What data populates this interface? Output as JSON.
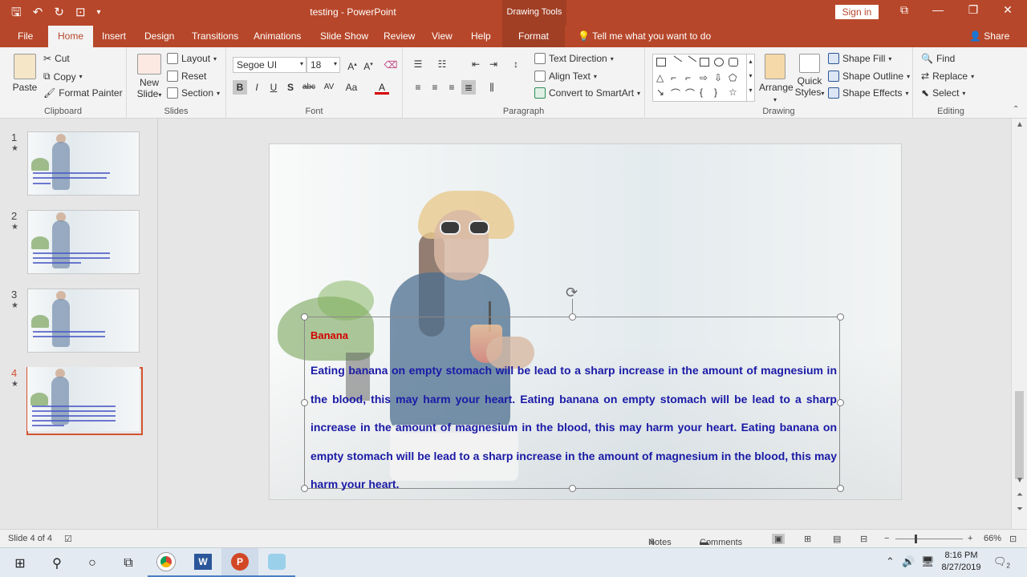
{
  "title_bar": {
    "document": "testing",
    "separator": "-",
    "app": "PowerPoint",
    "contextual": "Drawing Tools",
    "sign_in": "Sign in"
  },
  "tabs": [
    "File",
    "Home",
    "Insert",
    "Design",
    "Transitions",
    "Animations",
    "Slide Show",
    "Review",
    "View",
    "Help",
    "Format"
  ],
  "tell_me": "Tell me what you want to do",
  "share": "Share",
  "ribbon": {
    "clipboard": {
      "paste": "Paste",
      "cut": "Cut",
      "copy": "Copy",
      "format_painter": "Format Painter",
      "label": "Clipboard"
    },
    "slides": {
      "new_slide_1": "New",
      "new_slide_2": "Slide",
      "layout": "Layout",
      "reset": "Reset",
      "section": "Section",
      "label": "Slides"
    },
    "font": {
      "family": "Segoe UI",
      "size": "18",
      "bold": "B",
      "italic": "I",
      "underline": "U",
      "shadow": "S",
      "strike": "abc",
      "spacing": "AV",
      "case": "Aa",
      "color": "A",
      "label": "Font"
    },
    "paragraph": {
      "text_direction": "Text Direction",
      "align_text": "Align Text",
      "smartart": "Convert to SmartArt",
      "label": "Paragraph"
    },
    "drawing": {
      "arrange": "Arrange",
      "quick_styles_1": "Quick",
      "quick_styles_2": "Styles",
      "shape_fill": "Shape Fill",
      "shape_outline": "Shape Outline",
      "shape_effects": "Shape Effects",
      "label": "Drawing"
    },
    "editing": {
      "find": "Find",
      "replace": "Replace",
      "select": "Select",
      "label": "Editing"
    }
  },
  "slides": [
    {
      "number": "1"
    },
    {
      "number": "2"
    },
    {
      "number": "3"
    },
    {
      "number": "4"
    }
  ],
  "textbox": {
    "title": "Banana",
    "body": "Eating banana on empty stomach will be lead to a sharp increase in the amount of magnesium in the blood, this may harm your heart. Eating banana on empty stomach will be lead to a sharp increase in the amount of magnesium in the blood, this may harm your heart. Eating banana on empty stomach will be lead to a sharp increase in the amount of magnesium in the blood, this may harm your heart."
  },
  "status": {
    "slide_counter": "Slide 4 of 4",
    "notes": "Notes",
    "comments": "Comments",
    "zoom": "66%"
  },
  "taskbar": {
    "time": "8:16 PM",
    "date": "8/27/2019",
    "notification_count": "2"
  },
  "colors": {
    "accent": "#b7472a",
    "title_text": "#d40000",
    "body_text": "#1a1aa6",
    "active_thumb": "#d35230"
  },
  "icons": [
    "save-icon",
    "undo-icon",
    "redo-icon",
    "presenter-icon",
    "customize-icon",
    "lightbulb-icon",
    "person-icon",
    "cut-icon",
    "copy-icon",
    "format-painter-icon",
    "rotate-handle-icon",
    "start-icon",
    "search-icon",
    "cortana-icon",
    "task-view-icon",
    "notes-icon",
    "comments-icon",
    "view-normal-icon",
    "view-sorter-icon",
    "view-reading-icon",
    "view-slideshow-icon",
    "network-icon",
    "volume-icon",
    "notification-icon"
  ]
}
